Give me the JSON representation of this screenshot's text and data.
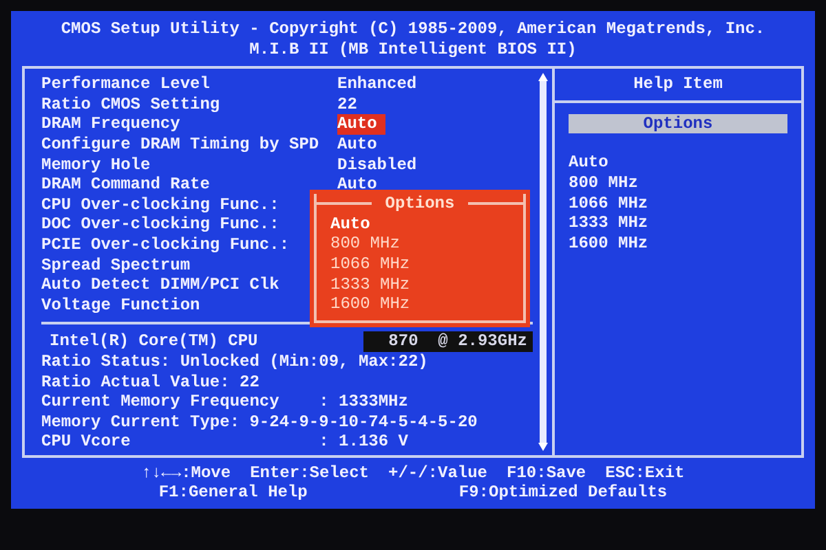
{
  "header": {
    "title": "CMOS Setup Utility - Copyright (C) 1985-2009, American Megatrends, Inc.",
    "subtitle": "M.I.B II (MB Intelligent BIOS II)"
  },
  "settings": [
    {
      "label": "Performance Level",
      "value": "Enhanced",
      "selected": false
    },
    {
      "label": "Ratio CMOS Setting",
      "value": "22",
      "selected": false
    },
    {
      "label": "DRAM Frequency",
      "value": "Auto",
      "selected": true
    },
    {
      "label": "Configure DRAM Timing by SPD",
      "value": "Auto",
      "selected": false
    },
    {
      "label": "Memory Hole",
      "value": "Disabled",
      "selected": false
    },
    {
      "label": "DRAM Command Rate",
      "value": "Auto",
      "selected": false
    },
    {
      "label": "CPU Over-clocking Func.:",
      "selected": false
    },
    {
      "label": "DOC Over-clocking Func.:",
      "selected": false
    },
    {
      "label": "PCIE Over-clocking Func.:",
      "selected": false
    },
    {
      "label": "Spread Spectrum",
      "selected": false
    },
    {
      "label": "Auto Detect DIMM/PCI Clk",
      "selected": false
    },
    {
      "label": "Voltage Function",
      "selected": false
    }
  ],
  "popup": {
    "title": "Options",
    "options": [
      {
        "label": "Auto",
        "selected": true
      },
      {
        "label": "800 MHz",
        "selected": false
      },
      {
        "label": "1066 MHz",
        "selected": false
      },
      {
        "label": "1333 MHz",
        "selected": false
      },
      {
        "label": "1600 MHz",
        "selected": false
      }
    ]
  },
  "cpu": {
    "label": "Intel(R) Core(TM) CPU",
    "value": "870  @ 2.93GHz"
  },
  "info_lines": [
    "Ratio Status: Unlocked (Min:09, Max:22)",
    "Ratio Actual Value: 22",
    "Current Memory Frequency    : 1333MHz",
    "Memory Current Type: 9-24-9-9-10-74-5-4-5-20",
    "CPU Vcore                   : 1.136 V"
  ],
  "help": {
    "title": "Help Item",
    "header": "Options",
    "lines": [
      "Auto",
      "800 MHz",
      "1066 MHz",
      "1333 MHz",
      "1600 MHz"
    ]
  },
  "footer": [
    [
      "↑↓←→:Move",
      "Enter:Select",
      "+/-/:Value",
      "F10:Save",
      "ESC:Exit"
    ],
    [
      "F1:General Help",
      "F9:Optimized Defaults"
    ]
  ]
}
